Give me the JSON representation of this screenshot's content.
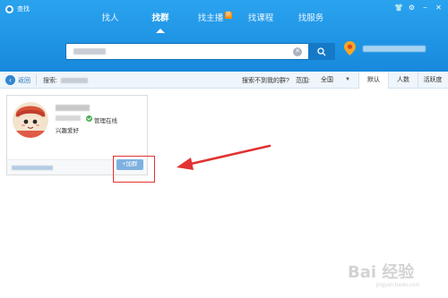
{
  "window": {
    "title": "查找"
  },
  "tabs": [
    {
      "label": "找人",
      "active": false
    },
    {
      "label": "找群",
      "active": true
    },
    {
      "label": "找主播",
      "active": false,
      "badge": "热"
    },
    {
      "label": "找课程",
      "active": false
    },
    {
      "label": "找服务",
      "active": false
    }
  ],
  "search": {
    "value": "",
    "placeholder": ""
  },
  "filter_bar": {
    "back_label": "返回",
    "search_label": "搜索:",
    "not_found_link": "搜索不到我的群?",
    "range_label": "范围:",
    "range_value": "全国",
    "sort_tabs": [
      "默认",
      "人数",
      "活跃度"
    ]
  },
  "result_card": {
    "verify_label": "管理在线",
    "tag": "兴趣爱好",
    "join_label": "+加群"
  },
  "watermark": {
    "brand": "Bai 经验",
    "sub": "jingyan.baidu.com"
  },
  "colors": {
    "header": "#1a8ad9",
    "accent": "#1479c7",
    "highlight": "#e23232"
  }
}
